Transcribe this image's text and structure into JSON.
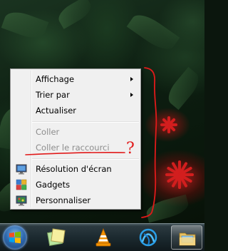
{
  "context_menu": {
    "items": [
      {
        "label": "Affichage",
        "has_submenu": true,
        "disabled": false,
        "icon": ""
      },
      {
        "label": "Trier par",
        "has_submenu": true,
        "disabled": false,
        "icon": ""
      },
      {
        "label": "Actualiser",
        "has_submenu": false,
        "disabled": false,
        "icon": ""
      },
      {
        "label": "Coller",
        "has_submenu": false,
        "disabled": true,
        "icon": ""
      },
      {
        "label": "Coller le raccourci",
        "has_submenu": false,
        "disabled": true,
        "icon": ""
      },
      {
        "label": "Résolution d'écran",
        "has_submenu": false,
        "disabled": false,
        "icon": "display-icon"
      },
      {
        "label": "Gadgets",
        "has_submenu": false,
        "disabled": false,
        "icon": "gadgets-icon"
      },
      {
        "label": "Personnaliser",
        "has_submenu": false,
        "disabled": false,
        "icon": "personalize-icon"
      }
    ]
  },
  "annotation": {
    "mark": "?",
    "color": "#e11a1a"
  },
  "taskbar": {
    "start_icon": "windows-logo-icon",
    "pinned": [
      {
        "name": "sticky-notes-icon"
      },
      {
        "name": "vlc-icon"
      },
      {
        "name": "battle-net-icon"
      },
      {
        "name": "windows-explorer-icon",
        "active": true
      }
    ]
  },
  "colors": {
    "menu_background": "#f0f0f0",
    "disabled_text": "#8d8d8d",
    "annotation_red": "#e11a1a"
  }
}
